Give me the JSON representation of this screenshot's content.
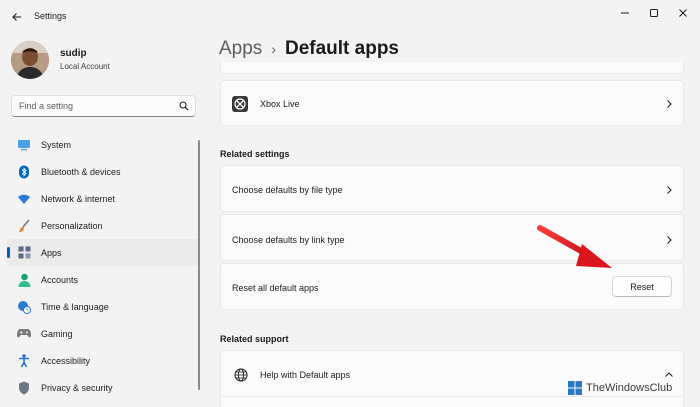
{
  "window": {
    "title": "Settings",
    "controls": [
      "minimize-icon",
      "maximize-icon",
      "close-icon"
    ]
  },
  "user": {
    "name": "sudip",
    "account_type": "Local Account"
  },
  "search": {
    "placeholder": "Find a setting",
    "value": ""
  },
  "sidebar": {
    "items": [
      {
        "label": "System",
        "icon": "system-icon",
        "color": "#0078d4"
      },
      {
        "label": "Bluetooth & devices",
        "icon": "bluetooth-icon",
        "color": "#0067c0"
      },
      {
        "label": "Network & internet",
        "icon": "wifi-icon",
        "color": "#2a7bd5"
      },
      {
        "label": "Personalization",
        "icon": "brush-icon",
        "color": "#e08a3c"
      },
      {
        "label": "Apps",
        "icon": "apps-icon",
        "color": "#5a6b85",
        "selected": true
      },
      {
        "label": "Accounts",
        "icon": "person-icon",
        "color": "#1aa57a"
      },
      {
        "label": "Time & language",
        "icon": "globe-clock-icon",
        "color": "#2a7bd5"
      },
      {
        "label": "Gaming",
        "icon": "gamepad-icon",
        "color": "#7a7a7a"
      },
      {
        "label": "Accessibility",
        "icon": "accessibility-icon",
        "color": "#1c6fd8"
      },
      {
        "label": "Privacy & security",
        "icon": "shield-icon",
        "color": "#6d7787"
      }
    ]
  },
  "breadcrumb": {
    "parent": "Apps",
    "current": "Default apps"
  },
  "main": {
    "xbox_item": {
      "label": "Xbox Live",
      "icon": "xbox-icon"
    },
    "related_settings": {
      "title": "Related settings",
      "items": [
        {
          "label": "Choose defaults by file type"
        },
        {
          "label": "Choose defaults by link type"
        }
      ],
      "reset": {
        "label": "Reset all default apps",
        "button": "Reset"
      }
    },
    "related_support": {
      "title": "Related support",
      "help": {
        "label": "Help with Default apps",
        "icon": "globe-icon"
      }
    }
  },
  "watermark": {
    "text": "TheWindowsClub"
  },
  "colors": {
    "accent": "#005fb8",
    "annotation_arrow": "#e11b22"
  }
}
